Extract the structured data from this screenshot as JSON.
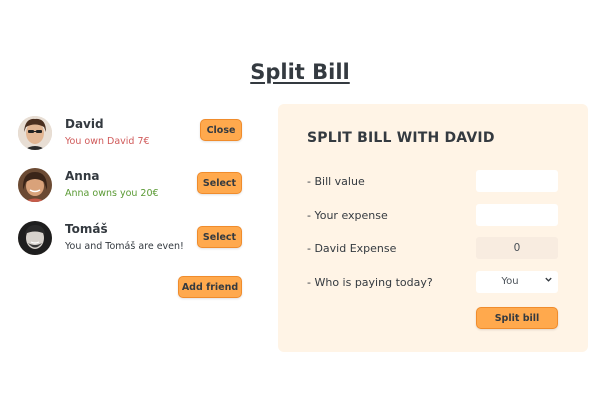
{
  "page": {
    "title": "Split Bill"
  },
  "friends": [
    {
      "name": "David",
      "status": "You own David 7€",
      "status_tone": "red",
      "button": "Close",
      "avatar": "avatar-david"
    },
    {
      "name": "Anna",
      "status": "Anna owns you 20€",
      "status_tone": "green",
      "button": "Select",
      "avatar": "avatar-anna"
    },
    {
      "name": "Tomáš",
      "status": "You and Tomáš are even!",
      "status_tone": "neutral",
      "button": "Select",
      "avatar": "avatar-tomas"
    }
  ],
  "add_friend_label": "Add friend",
  "form": {
    "heading": "SPLIT BILL WITH DAVID",
    "bill_value_label": "-  Bill value",
    "bill_value": "",
    "your_expense_label": "-  Your expense",
    "your_expense": "",
    "friend_expense_label": "-  David Expense",
    "friend_expense": "0",
    "payer_label": "-  Who is paying today?",
    "payer_selected": "You",
    "submit_label": "Split bill"
  },
  "colors": {
    "accent": "#ffa94d",
    "panel_bg": "#fff4e6",
    "owe_red": "#d05a5a",
    "owed_green": "#5a9a34",
    "text": "#343a40"
  }
}
